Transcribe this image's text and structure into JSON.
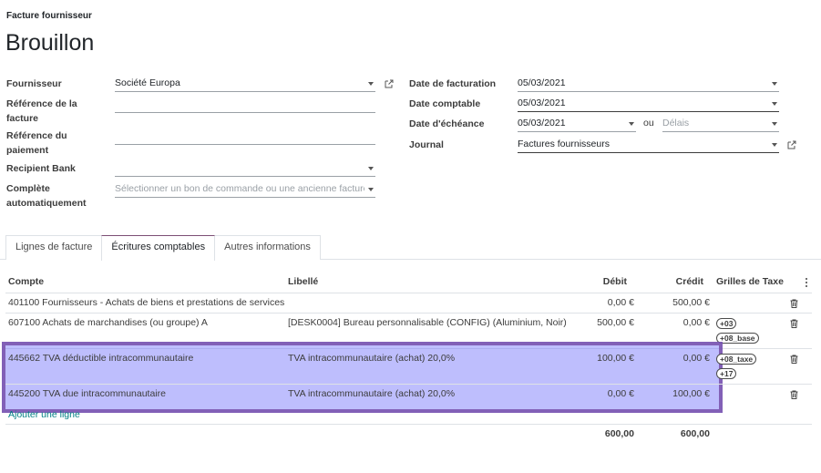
{
  "header": {
    "subtitle": "Facture fournisseur",
    "title": "Brouillon"
  },
  "form_left": {
    "fournisseur_label": "Fournisseur",
    "fournisseur_value": "Société Europa",
    "ref_facture_label_1": "Référence de la",
    "ref_facture_label_2": "facture",
    "ref_paiement_label_1": "Référence du",
    "ref_paiement_label_2": "paiement",
    "recipient_bank_label": "Recipient Bank",
    "complete_label_1": "Complète",
    "complete_label_2": "automatiquement",
    "complete_placeholder": "Sélectionner un bon de commande ou une ancienne facture"
  },
  "form_right": {
    "date_facturation_label": "Date de facturation",
    "date_facturation_value": "05/03/2021",
    "date_comptable_label": "Date comptable",
    "date_comptable_value": "05/03/2021",
    "date_echeance_label": "Date d'échéance",
    "date_echeance_value": "05/03/2021",
    "ou": "ou",
    "delais_placeholder": "Délais",
    "journal_label": "Journal",
    "journal_value": "Factures fournisseurs"
  },
  "tabs": [
    {
      "label": "Lignes de facture"
    },
    {
      "label": "Écritures comptables"
    },
    {
      "label": "Autres informations"
    }
  ],
  "table": {
    "headers": {
      "compte": "Compte",
      "libelle": "Libellé",
      "debit": "Débit",
      "credit": "Crédit",
      "grilles": "Grilles de Taxe"
    },
    "rows": [
      {
        "compte": "401100 Fournisseurs - Achats de biens et prestations de services",
        "libelle": "",
        "debit": "0,00 €",
        "credit": "500,00 €",
        "tags": []
      },
      {
        "compte": "607100 Achats de marchandises (ou groupe) A",
        "libelle": "[DESK0004] Bureau personnalisable (CONFIG) (Aluminium, Noir)",
        "debit": "500,00 €",
        "credit": "0,00 €",
        "tags": [
          "+03",
          "+08_base"
        ]
      },
      {
        "compte": "445662 TVA déductible intracommunautaire",
        "libelle": "TVA intracommunautaire (achat) 20,0%",
        "debit": "100,00 €",
        "credit": "0,00 €",
        "tags": [
          "+08_taxe",
          "+17"
        ]
      },
      {
        "compte": "445200 TVA due intracommunautaire",
        "libelle": "TVA intracommunautaire (achat) 20,0%",
        "debit": "0,00 €",
        "credit": "100,00 €",
        "tags": []
      }
    ],
    "add_line": "Ajouter une ligne",
    "total_debit": "600,00",
    "total_credit": "600,00"
  }
}
